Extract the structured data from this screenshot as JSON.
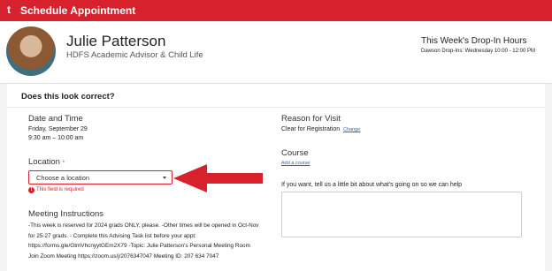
{
  "topbar": {
    "logo": "t",
    "title": "Schedule Appointment"
  },
  "advisor": {
    "name": "Julie Patterson",
    "role": "HDFS Academic Advisor & Child Life",
    "dropin_title": "This Week's Drop-In Hours",
    "dropin_text": "Dawson Drop-Ins: Wednesday 10:00 - 12:00 PM"
  },
  "form": {
    "confirm_title": "Does this look correct?",
    "date_time": {
      "label": "Date and Time",
      "date": "Friday, September 29",
      "time": "9:30 am – 10:00 am"
    },
    "location": {
      "label": "Location",
      "required_mark": "*",
      "selected": "Choose a location",
      "error": "This field is required"
    },
    "meeting": {
      "label": "Meeting Instructions",
      "text": "-This week is reserved for 2024 grads ONLY, please. -Other times will be opened in Oct-Nov for 25-27 grads. - Complete this Advising Task list before your appt: https://forms.gle/GtmVhcnyytGEm2X79 -Topic: Julie Patterson's Personal Meeting Room Join Zoom Meeting https://zoom.us/j/2076347047 Meeting ID: 207 634 7047"
    },
    "reason": {
      "label": "Reason for Visit",
      "value": "Clear for Registration",
      "change_link": "Change"
    },
    "course": {
      "label": "Course",
      "add_link": "Add a course"
    },
    "notes": {
      "label": "If you want, tell us a little bit about what's going on so we can help"
    }
  },
  "colors": {
    "brand_red": "#d7222d",
    "link_blue": "#2a6db5"
  }
}
